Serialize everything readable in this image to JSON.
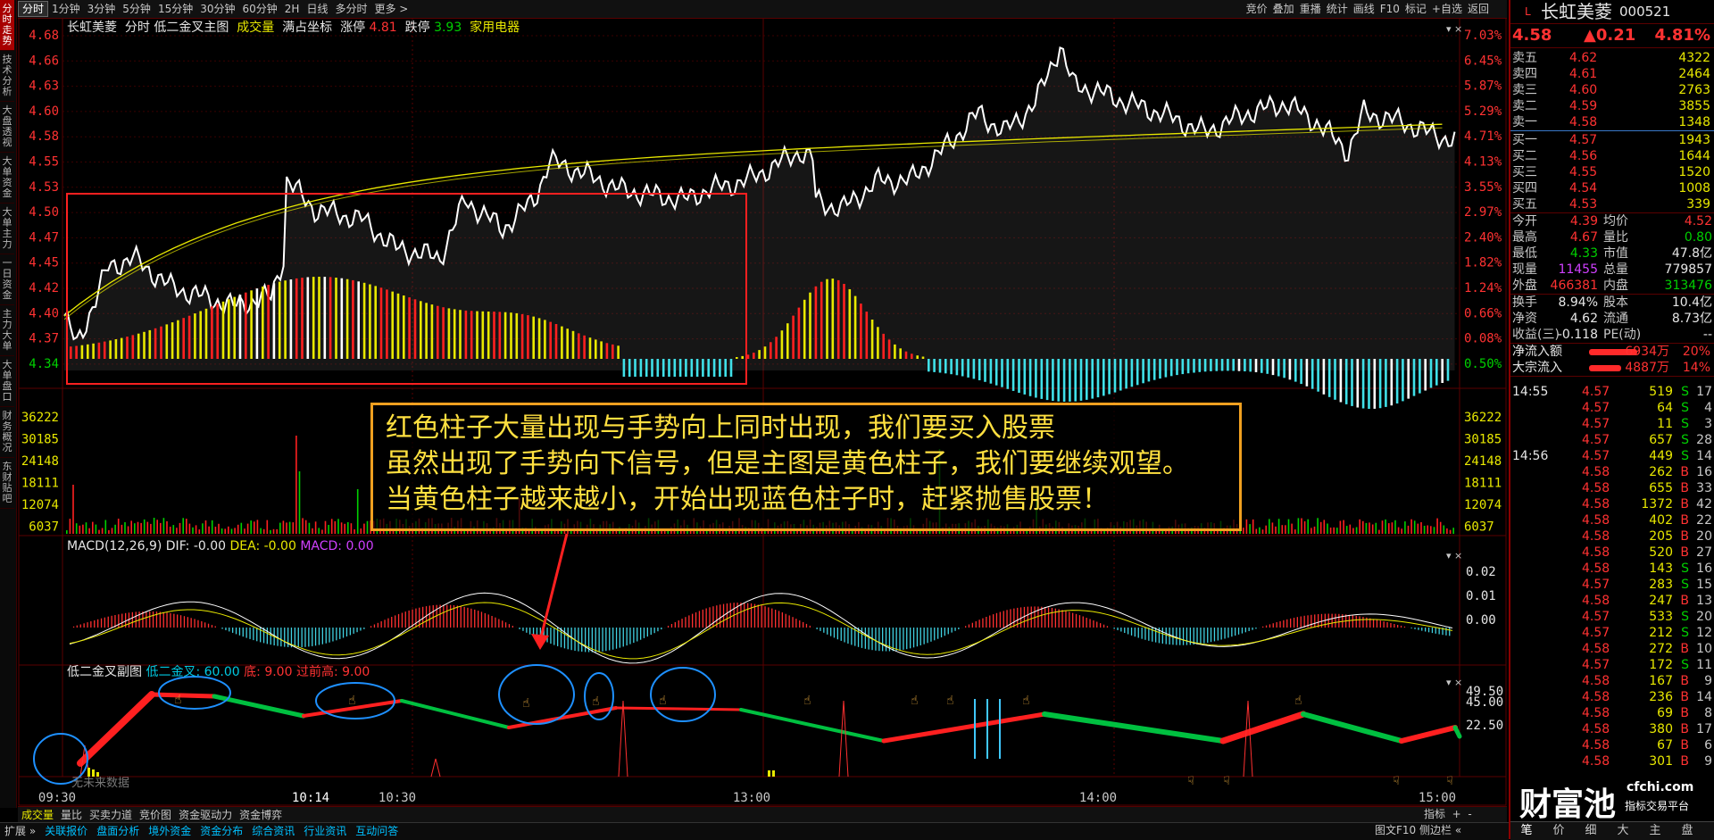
{
  "left_nav": [
    "分时走势",
    "技术分析",
    "大盘透视",
    "大单资金",
    "大单主力",
    "一日资金",
    "主力大单",
    "大单盘口",
    "财务概况",
    "东财贴吧"
  ],
  "period_tabs": [
    "分时",
    "1分钟",
    "3分钟",
    "5分钟",
    "15分钟",
    "30分钟",
    "60分钟",
    "2H",
    "日线",
    "多分时",
    "更多 >"
  ],
  "toolbar": [
    "竞价",
    "叠加",
    "重播",
    "统计",
    "画线",
    "F10",
    "标记",
    "+自选",
    "返回"
  ],
  "main_header": {
    "name": "长虹美菱",
    "items": "分时 低二金叉主图",
    "vol_label": "成交量",
    "coord": "满占坐标",
    "limit_up_label": "涨停",
    "limit_up": "4.81",
    "limit_down_label": "跌停",
    "limit_down": "3.93",
    "sector": "家用电器"
  },
  "price_axis": [
    "4.68",
    "4.66",
    "4.63",
    "4.60",
    "4.58",
    "4.55",
    "4.53",
    "4.50",
    "4.47",
    "4.45",
    "4.42",
    "4.40",
    "4.37",
    "4.34"
  ],
  "pct_axis": [
    "7.03%",
    "6.45%",
    "5.87%",
    "5.29%",
    "4.71%",
    "4.13%",
    "3.55%",
    "2.97%",
    "2.40%",
    "1.82%",
    "1.24%",
    "0.66%",
    "0.08%",
    "0.50%"
  ],
  "vol_axis": [
    "36222",
    "30185",
    "24148",
    "18111",
    "12074",
    "6037"
  ],
  "macd": {
    "label": "MACD(12,26,9)",
    "dif": "DIF: -0.00",
    "dea": "DEA: -0.00",
    "macd": "MACD: 0.00",
    "axis": [
      "0.02",
      "0.01",
      "0.00"
    ]
  },
  "sub": {
    "label": "低二金叉副图",
    "cross": "低二金叉: 60.00",
    "bottom": "底: 9.00",
    "prevhigh": "过前高: 9.00",
    "axis": [
      "49.50",
      "45.00",
      "22.50"
    ],
    "watermark": "无未来数据"
  },
  "time_axis": [
    "09:30",
    "10:14",
    "10:30",
    "13:00",
    "14:00",
    "15:00"
  ],
  "annotation": [
    "红色柱子大量出现与手势向上同时出现，我们要买入股票",
    "虽然出现了手势向下信号，但是主图是黄色柱子，我们要继续观望。",
    "当黄色柱子越来越小，开始出现蓝色柱子时，赶紧抛售股票！"
  ],
  "bottom_tabs": [
    "成交量",
    "量比",
    "买卖力道",
    "竞价图",
    "资金驱动力",
    "资金博弈"
  ],
  "bottom_right": [
    "指标",
    "+",
    "-"
  ],
  "status_tabs": [
    "扩展 »",
    "关联报价",
    "盘面分析",
    "境外资金",
    "资金分布",
    "综合资讯",
    "行业资讯",
    "互动问答"
  ],
  "status_right": [
    "图文F10",
    "侧边栏 «"
  ],
  "quote": {
    "flag": "L",
    "name": "长虹美菱",
    "code": "000521",
    "price": "4.58",
    "change": "▲0.21",
    "pct": "4.81%",
    "asks": [
      {
        "l": "卖五",
        "p": "4.62",
        "v": "4322"
      },
      {
        "l": "卖四",
        "p": "4.61",
        "v": "2464"
      },
      {
        "l": "卖三",
        "p": "4.60",
        "v": "2763"
      },
      {
        "l": "卖二",
        "p": "4.59",
        "v": "3855"
      },
      {
        "l": "卖一",
        "p": "4.58",
        "v": "1348"
      }
    ],
    "bids": [
      {
        "l": "买一",
        "p": "4.57",
        "v": "1943"
      },
      {
        "l": "买二",
        "p": "4.56",
        "v": "1644"
      },
      {
        "l": "买三",
        "p": "4.55",
        "v": "1520"
      },
      {
        "l": "买四",
        "p": "4.54",
        "v": "1008"
      },
      {
        "l": "买五",
        "p": "4.53",
        "v": "339"
      }
    ],
    "stats": [
      [
        "今开",
        "4.39",
        "均价",
        "4.52"
      ],
      [
        "最高",
        "4.67",
        "量比",
        "0.80"
      ],
      [
        "最低",
        "4.33",
        "市值",
        "47.8亿"
      ],
      [
        "现量",
        "11455",
        "总量",
        "779857"
      ],
      [
        "外盘",
        "466381",
        "内盘",
        "313476"
      ],
      [
        "换手",
        "8.94%",
        "股本",
        "10.4亿"
      ],
      [
        "净资",
        "4.62",
        "流通",
        "8.73亿"
      ],
      [
        "收益(三)",
        "-0.118",
        "PE(动)",
        "--"
      ]
    ],
    "flows": [
      {
        "l": "净流入额",
        "v": "6934万",
        "p": "20%"
      },
      {
        "l": "大宗流入",
        "v": "4887万",
        "p": "14%"
      }
    ],
    "ticks": [
      [
        "14:55",
        "4.57",
        "519",
        "S",
        "17"
      ],
      [
        "",
        "4.57",
        "64",
        "S",
        "4"
      ],
      [
        "",
        "4.57",
        "11",
        "S",
        "3"
      ],
      [
        "",
        "4.57",
        "657",
        "S",
        "28"
      ],
      [
        "14:56",
        "4.57",
        "449",
        "S",
        "14"
      ],
      [
        "",
        "4.58",
        "262",
        "B",
        "16"
      ],
      [
        "",
        "4.58",
        "655",
        "B",
        "33"
      ],
      [
        "",
        "4.58",
        "1372",
        "B",
        "42"
      ],
      [
        "",
        "4.58",
        "402",
        "B",
        "22"
      ],
      [
        "",
        "4.58",
        "205",
        "B",
        "20"
      ],
      [
        "",
        "4.58",
        "520",
        "B",
        "27"
      ],
      [
        "",
        "4.58",
        "143",
        "S",
        "16"
      ],
      [
        "",
        "4.57",
        "283",
        "S",
        "15"
      ],
      [
        "",
        "4.58",
        "247",
        "B",
        "13"
      ],
      [
        "",
        "4.57",
        "533",
        "S",
        "20"
      ],
      [
        "",
        "4.57",
        "212",
        "S",
        "12"
      ],
      [
        "",
        "4.58",
        "272",
        "B",
        "10"
      ],
      [
        "",
        "4.57",
        "172",
        "S",
        "11"
      ],
      [
        "",
        "4.58",
        "167",
        "B",
        "9"
      ],
      [
        "",
        "4.58",
        "236",
        "B",
        "14"
      ],
      [
        "",
        "4.58",
        "69",
        "B",
        "8"
      ],
      [
        "",
        "4.58",
        "380",
        "B",
        "17"
      ],
      [
        "",
        "4.58",
        "67",
        "B",
        "6"
      ],
      [
        "",
        "4.58",
        "301",
        "B",
        "9"
      ]
    ],
    "right_tabs": [
      "笔",
      "价",
      "细",
      "大",
      "主",
      "盘"
    ],
    "logo": "财富池",
    "logo_site": "cfchi.com",
    "logo_sub": "指标交易平台"
  }
}
